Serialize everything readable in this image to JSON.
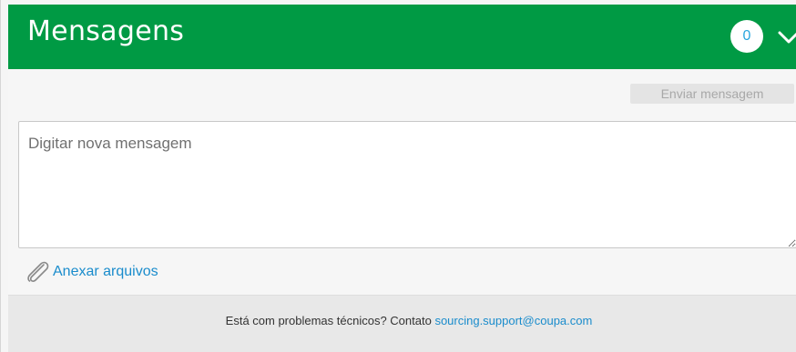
{
  "header": {
    "title": "Mensagens",
    "message_count": "0",
    "toggle_icon": "chevron-down-icon",
    "background_color": "#009a44"
  },
  "composer": {
    "send_button_label": "Enviar mensagem",
    "message_placeholder": "Digitar nova mensagem",
    "message_value": "",
    "attach_label": "Anexar arquivos",
    "attach_icon": "paperclip-icon"
  },
  "footer": {
    "support_text": "Está com problemas técnicos? Contato ",
    "support_email": "sourcing.support@coupa.com",
    "link_color": "#1a8ccc"
  }
}
